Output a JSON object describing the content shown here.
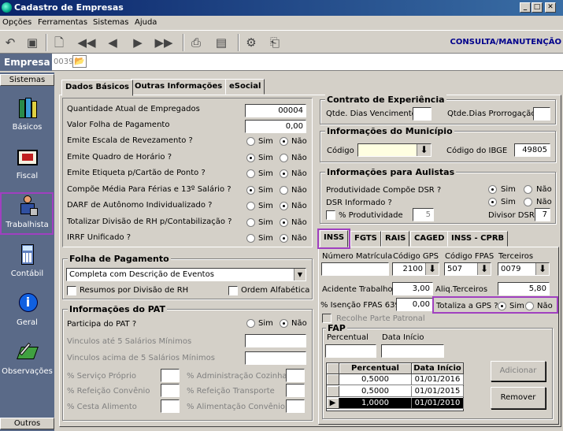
{
  "window": {
    "title": "Cadastro de Empresas",
    "buttons": [
      "_",
      "□",
      "✕"
    ]
  },
  "menu": [
    "Opções",
    "Ferramentas",
    "Sistemas",
    "Ajuda"
  ],
  "toolbar": {
    "mode": "CONSULTA/MANUTENÇÃO"
  },
  "empresa": {
    "label": "Empresa",
    "code": "0039"
  },
  "sidebar": {
    "top": "Sistemas",
    "bottom": "Outros",
    "items": [
      {
        "label": "Básicos",
        "icon": "books-icon"
      },
      {
        "label": "Fiscal",
        "icon": "ledger-icon"
      },
      {
        "label": "Trabalhista",
        "icon": "worker-icon"
      },
      {
        "label": "Contábil",
        "icon": "calculator-icon"
      },
      {
        "label": "Geral",
        "icon": "info-icon"
      },
      {
        "label": "Observações",
        "icon": "notes-icon"
      }
    ]
  },
  "tabs": [
    "Dados Básicos",
    "Outras Informações",
    "eSocial"
  ],
  "basic": {
    "qtd_label": "Quantidade Atual de Empregados",
    "qtd_value": "00004",
    "folha_label": "Valor Folha de Pagamento",
    "folha_value": "0,00",
    "questions": [
      {
        "label": "Emite Escala de Revezamento ?",
        "value": "Não"
      },
      {
        "label": "Emite Quadro de Horário ?",
        "value": "Sim"
      },
      {
        "label": "Emite Etiqueta p/Cartão de Ponto ?",
        "value": "Não"
      },
      {
        "label": "Compõe Média Para Férias e 13º Salário ?",
        "value": "Sim"
      },
      {
        "label": "DARF de Autônomo Individualizado ?",
        "value": "Não"
      },
      {
        "label": "Totalizar Divisão de RH p/Contabilização ?",
        "value": "Não"
      },
      {
        "label": "IRRF Unificado ?",
        "value": "Não"
      }
    ],
    "sim": "Sim",
    "nao": "Não"
  },
  "folha": {
    "title": "Folha de Pagamento",
    "select": "Completa com Descrição de Eventos",
    "resumos": "Resumos por Divisão de RH",
    "ordem": "Ordem Alfabética"
  },
  "pat": {
    "title": "Informações do PAT",
    "participa": "Participa do PAT ?",
    "participa_value": "Não",
    "vinc_ate": "Vinculos até 5 Salários Mínimos",
    "vinc_acima": "Vinculos acima de 5 Salários Mínimos",
    "servico": "% Serviço Próprio",
    "admin": "% Administração Cozinha",
    "refeicao": "% Refeição Convênio",
    "ref_transp": "% Refeição Transporte",
    "cesta": "% Cesta Alimento",
    "aliment": "% Alimentação Convênio"
  },
  "contrato": {
    "title": "Contrato de Experiência",
    "venc": "Qtde. Dias Vencimento",
    "prorr": "Qtde.Dias Prorrogação"
  },
  "municipio": {
    "title": "Informações do Município",
    "codigo": "Código",
    "ibge_label": "Código do IBGE",
    "ibge": "49805"
  },
  "aulistas": {
    "title": "Informações para Aulistas",
    "dsr": "Produtividade Compõe DSR ?",
    "dsr_value": "Sim",
    "dsr_inf": "DSR Informado ?",
    "dsr_inf_value": "Sim",
    "prod": "% Produtividade",
    "prod_value": "5",
    "divisor": "Divisor DSR",
    "divisor_value": "7"
  },
  "subtabs": [
    "INSS",
    "FGTS",
    "RAIS",
    "CAGED",
    "INSS - CPRB"
  ],
  "inss": {
    "matricula": "Número Matrícula",
    "gps_label": "Código GPS",
    "gps": "2100",
    "fpas_label": "Código FPAS",
    "fpas": "507",
    "terc_label": "Terceiros",
    "terc": "0079",
    "acid_label": "Acidente Trabalho",
    "acid": "3,00",
    "aliq_label": "Aliq.Terceiros",
    "aliq": "5,80",
    "isencao_label": "% Isenção FPAS 639",
    "isencao": "0,00",
    "totaliza": "Totaliza a GPS ?",
    "totaliza_value": "Sim",
    "recolhe": "Recolhe Parte Patronal"
  },
  "fap": {
    "title": "FAP",
    "percentual": "Percentual",
    "data": "Data Início",
    "cols": [
      "Percentual",
      "Data Início"
    ],
    "rows": [
      {
        "pct": "0,5000",
        "date": "01/01/2016"
      },
      {
        "pct": "0,5000",
        "date": "01/01/2015"
      },
      {
        "pct": "1,0000",
        "date": "01/01/2010"
      }
    ],
    "add": "Adicionar",
    "remove": "Remover"
  }
}
